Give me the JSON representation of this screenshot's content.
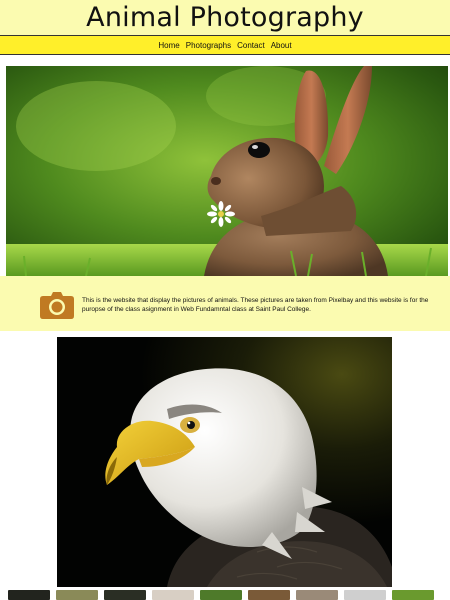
{
  "header": {
    "title": "Animal Photography"
  },
  "nav": [
    {
      "label": "Home"
    },
    {
      "label": "Photographs"
    },
    {
      "label": "Contact"
    },
    {
      "label": "About"
    }
  ],
  "hero": {
    "image": "rabbit-photo"
  },
  "info": {
    "icon": "camera-icon",
    "text": "This is the website that display the pictures of animals. These pictures are taken from Pixelbay and this website is for the puropse of the class asignment in Web Fundamntal class at Saint Paul College."
  },
  "feature": {
    "image": "bald-eagle-photo"
  },
  "colors": {
    "header_bg": "#fbfbb0",
    "nav_bg": "#ffef2a",
    "camera": "#c07a22"
  },
  "thumbnails": [
    {
      "name": "thumbnail-1",
      "color": "#22241e"
    },
    {
      "name": "thumbnail-2",
      "color": "#8a8a58"
    },
    {
      "name": "thumbnail-3",
      "color": "#2a2e24"
    },
    {
      "name": "thumbnail-4",
      "color": "#d8cfc4"
    },
    {
      "name": "thumbnail-5",
      "color": "#4e7a2a"
    },
    {
      "name": "thumbnail-6",
      "color": "#7a5a38"
    },
    {
      "name": "thumbnail-7",
      "color": "#9a8a78"
    },
    {
      "name": "thumbnail-8",
      "color": "#cfcfcf"
    },
    {
      "name": "thumbnail-9",
      "color": "#6a9a2e"
    }
  ]
}
